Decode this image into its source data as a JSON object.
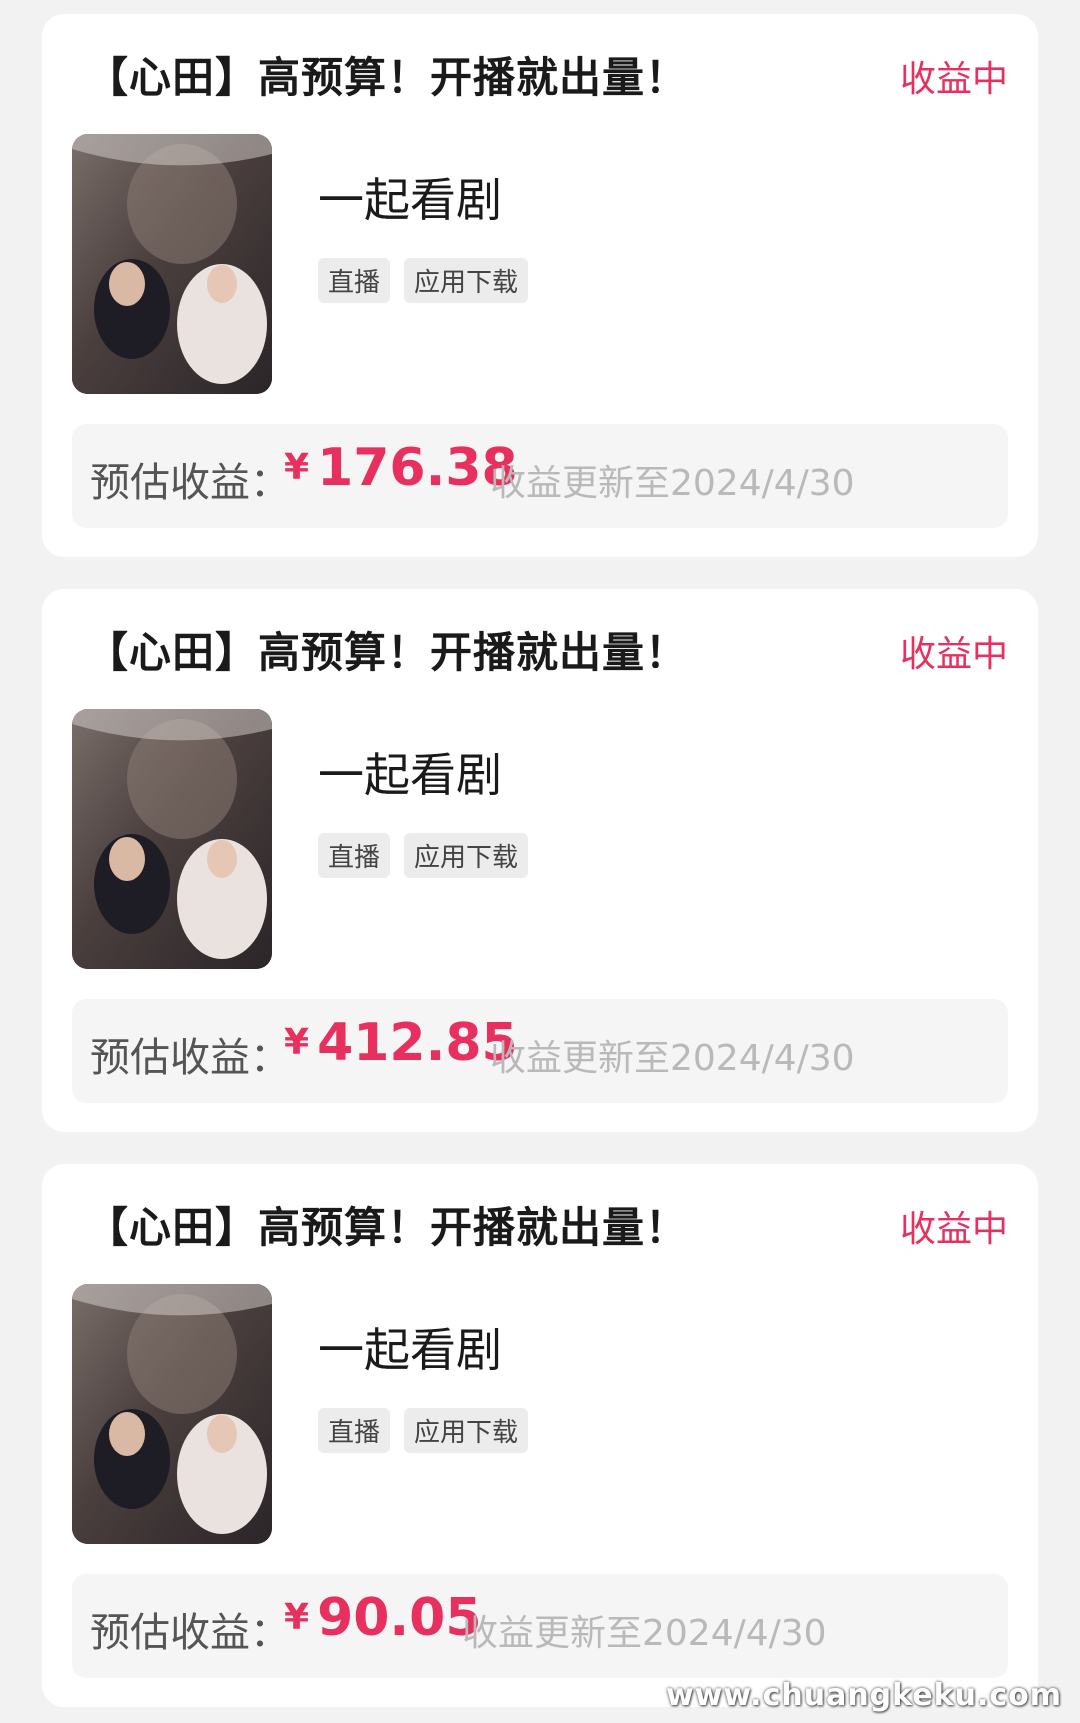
{
  "cards": [
    {
      "title": "【心田】高预算！开播就出量！",
      "status": "收益中",
      "app_name": "一起看剧",
      "tags": [
        "直播",
        "应用下载"
      ],
      "earnings_label": "预估收益：",
      "currency": "¥",
      "amount": "176.38",
      "update_text": "收益更新至2024/4/30"
    },
    {
      "title": "【心田】高预算！开播就出量！",
      "status": "收益中",
      "app_name": "一起看剧",
      "tags": [
        "直播",
        "应用下载"
      ],
      "earnings_label": "预估收益：",
      "currency": "¥",
      "amount": "412.85",
      "update_text": "收益更新至2024/4/30"
    },
    {
      "title": "【心田】高预算！开播就出量！",
      "status": "收益中",
      "app_name": "一起看剧",
      "tags": [
        "直播",
        "应用下载"
      ],
      "earnings_label": "预估收益：",
      "currency": "¥",
      "amount": "90.05",
      "update_text": "收益更新至2024/4/30"
    }
  ],
  "watermark": "www.chuangkeku.com",
  "colors": {
    "accent": "#e8305f",
    "background": "#f2f2f2",
    "card": "#ffffff",
    "muted_text": "#b9b9b9"
  }
}
